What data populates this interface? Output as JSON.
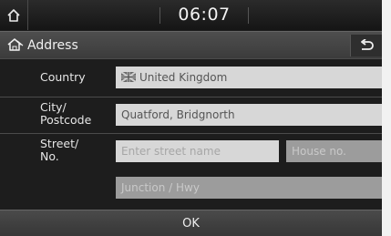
{
  "status_bar": {
    "time": "06:07",
    "home_icon": "home-icon"
  },
  "header": {
    "title": "Address",
    "title_icon": "address-house-icon",
    "back_icon": "back-arrow-icon"
  },
  "form": {
    "country": {
      "label": "Country",
      "value": "United Kingdom",
      "flag_icon": "uk-flag-icon"
    },
    "city": {
      "label_line1": "City/",
      "label_line2": "Postcode",
      "value": "Quatford, Bridgnorth"
    },
    "street": {
      "label_line1": "Street/",
      "label_line2": "No.",
      "placeholder": "Enter street name",
      "house_no_placeholder": "House no.",
      "cross_street_placeholder": "Junction / Hwy"
    }
  },
  "ok_button": {
    "label": "OK"
  },
  "colors": {
    "background": "#1d1d1d",
    "field_active": "#d7d7d7",
    "field_disabled": "#9c9c9c",
    "text": "#e6e6e6"
  }
}
